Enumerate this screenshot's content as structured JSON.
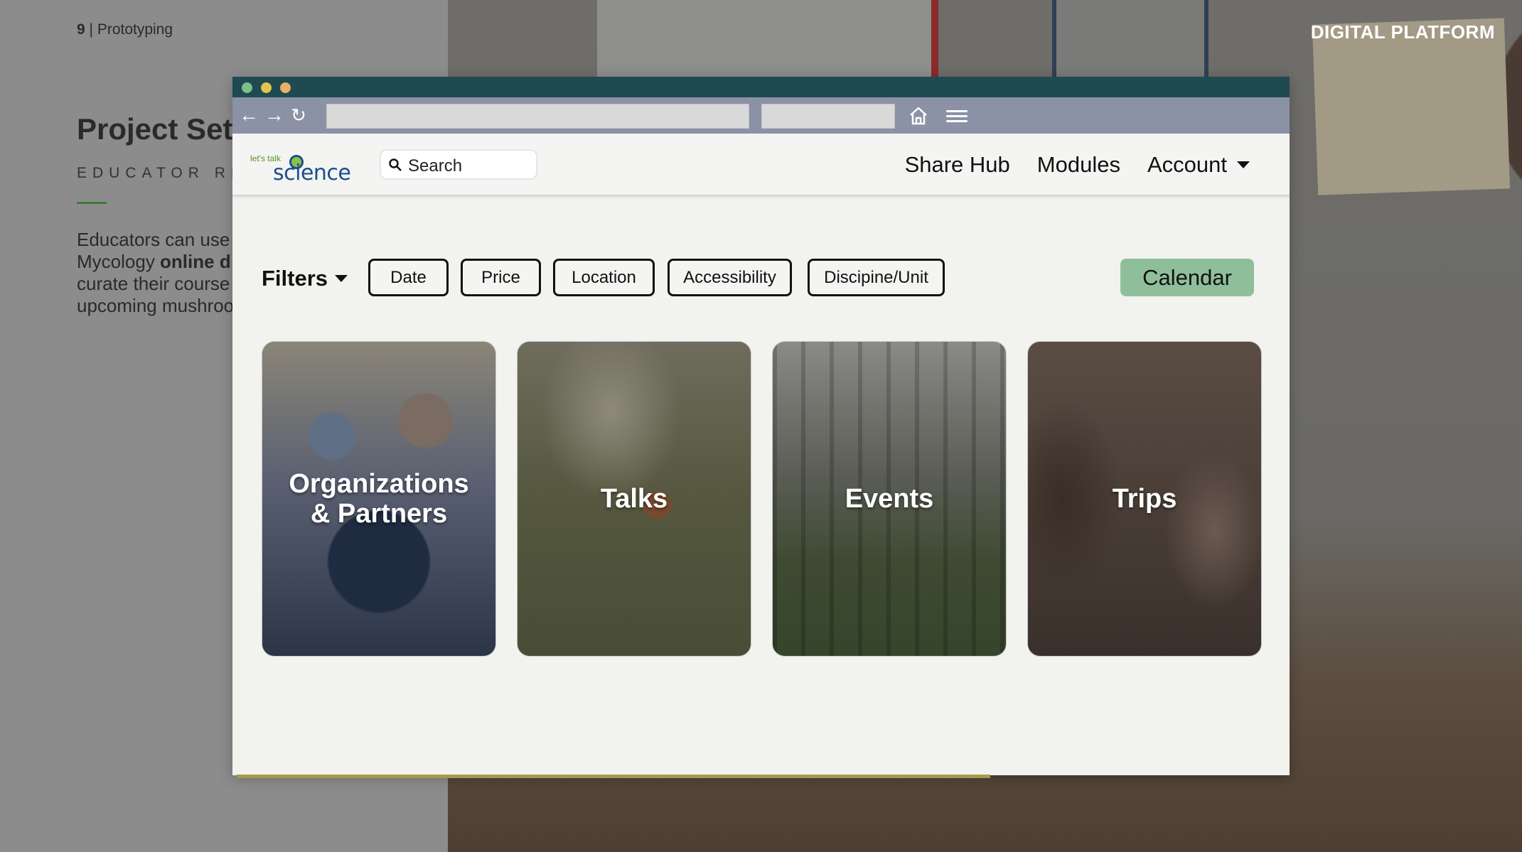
{
  "slide": {
    "page_number": "9",
    "section": "Prototyping",
    "corner_label": "DIGITAL PLATFORM",
    "title": "Project Set",
    "subtitle": "EDUCATOR RES",
    "body_lines": [
      {
        "text": "Educators can use",
        "bold": ""
      },
      {
        "text": "Mycology ",
        "bold": "online d"
      },
      {
        "text": "curate their course",
        "bold": ""
      },
      {
        "text": "upcoming mushroo",
        "bold": ""
      }
    ]
  },
  "browser": {
    "url": "",
    "search_text": ""
  },
  "site": {
    "logo": {
      "small": "let's talk",
      "big": "science"
    },
    "search_placeholder": "Search",
    "nav": {
      "share_hub": "Share Hub",
      "modules": "Modules",
      "account": "Account"
    },
    "filters": {
      "label": "Filters",
      "pills": [
        "Date",
        "Price",
        "Location",
        "Accessibility",
        "Discipine/Unit"
      ],
      "calendar": "Calendar"
    },
    "cards": [
      {
        "title_line1": "Organizations",
        "title_line2": "& Partners"
      },
      {
        "title_line1": "Talks",
        "title_line2": ""
      },
      {
        "title_line1": "Events",
        "title_line2": ""
      },
      {
        "title_line1": "Trips",
        "title_line2": ""
      }
    ]
  },
  "colors": {
    "titlebar": "#1e4a50",
    "toolbar": "#8b92a6",
    "calendar_button": "#8fbf9a",
    "page_background": "#f2f2ef"
  }
}
